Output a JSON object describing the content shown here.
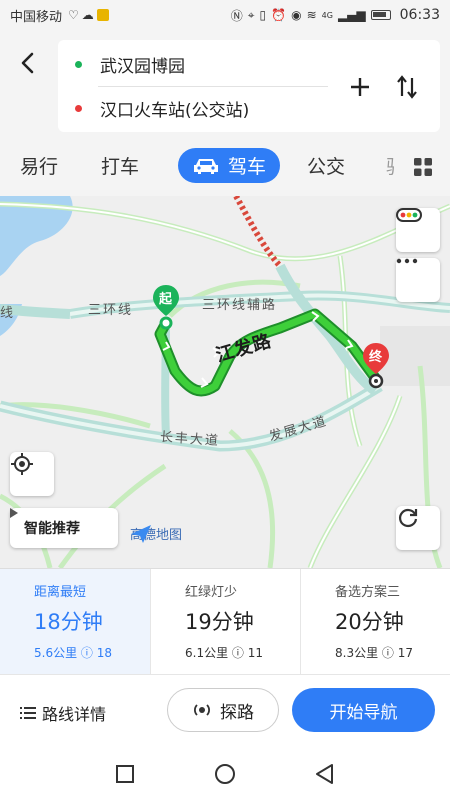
{
  "status_bar": {
    "carrier": "中国移动",
    "icons": [
      "heart-rate-icon",
      "cloud-icon",
      "sim-card-icon",
      "nfc-icon",
      "location-icon",
      "vibrate-icon",
      "alarm-icon",
      "eye-icon",
      "wifi-icon",
      "signal-icon",
      "battery-icon"
    ],
    "signal_label": "4G",
    "time": "06:33"
  },
  "route": {
    "origin": "武汉园博园",
    "destination": "汉口火车站(公交站)",
    "origin_color": "#1bb35a",
    "destination_color": "#e83b3b"
  },
  "tabs": [
    {
      "label": "易行",
      "active": false
    },
    {
      "label": "打车",
      "active": false
    },
    {
      "label": "驾车",
      "active": true
    },
    {
      "label": "公交",
      "active": false
    },
    {
      "label": "骑",
      "active": false
    }
  ],
  "map": {
    "road_labels": {
      "ring_road_left": "三环线",
      "ring_road_edge": "线",
      "ring_road_aux": "三环线辅路",
      "main_road": "江发路",
      "changfeng_road": "长丰大道",
      "fazhan_road": "发展大道"
    },
    "start_marker": "起",
    "end_marker": "终",
    "recommend_label": "智能推荐",
    "logo_text": "高德地图",
    "route_color": "#27b232",
    "accent": "#2f7df6"
  },
  "plans": [
    {
      "title": "距离最短",
      "time": "18分钟",
      "distance": "5.6公里",
      "lights": "18",
      "active": true
    },
    {
      "title": "红绿灯少",
      "time": "19分钟",
      "distance": "6.1公里",
      "lights": "11",
      "active": false
    },
    {
      "title": "备选方案三",
      "time": "20分钟",
      "distance": "8.3公里",
      "lights": "17",
      "active": false
    }
  ],
  "actions": {
    "detail_label": "路线详情",
    "probe_label": "探路",
    "navigate_label": "开始导航"
  }
}
